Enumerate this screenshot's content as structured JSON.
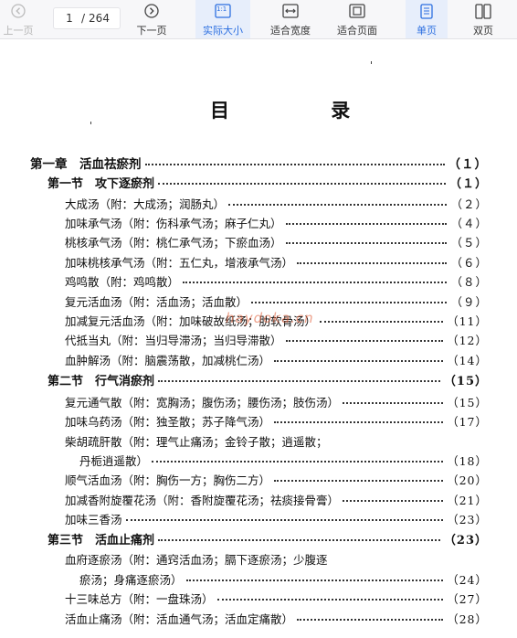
{
  "toolbar": {
    "prev_label": "上一页",
    "page_current": "1",
    "page_sep": "/",
    "page_total": "264",
    "next_label": "下一页",
    "actual_size_label": "实际大小",
    "actual_size_icon_text": "1:1",
    "fit_width_label": "适合宽度",
    "fit_page_label": "适合页面",
    "single_page_label": "单页",
    "double_page_label": "双页"
  },
  "document": {
    "title": "目 录",
    "watermark": "haydoka.cn",
    "lines": [
      {
        "level": "chapter",
        "text": "第一章　活血祛瘀剂",
        "page": "（１）"
      },
      {
        "level": "section",
        "text": "第一节　攻下逐瘀剂",
        "page": "（１）"
      },
      {
        "level": "item",
        "text": "大成汤（附：大成汤；润肠丸）",
        "page": "（２）"
      },
      {
        "level": "item",
        "text": "加味承气汤（附：伤科承气汤；麻子仁丸）",
        "page": "（４）"
      },
      {
        "level": "item",
        "text": "桃核承气汤（附：桃仁承气汤；下瘀血汤）",
        "page": "（５）"
      },
      {
        "level": "item",
        "text": "加味桃核承气汤（附：五仁丸，增液承气汤）",
        "page": "（６）"
      },
      {
        "level": "item",
        "text": "鸡鸣散（附：鸡鸣散）",
        "page": "（８）"
      },
      {
        "level": "item",
        "text": "复元活血汤（附：活血汤；活血散）",
        "page": "（９）"
      },
      {
        "level": "item",
        "text": "加减复元活血汤（附：加味破故纸汤；肋软骨汤）",
        "page": "（11）"
      },
      {
        "level": "item",
        "text": "代抵当丸（附：当归导滞汤；当归导滞散）",
        "page": "（12）"
      },
      {
        "level": "item",
        "text": "血肿解汤（附：脑震荡散，加减桃仁汤）",
        "page": "（14）"
      },
      {
        "level": "section",
        "text": "第二节　行气消瘀剂",
        "page": "（15）"
      },
      {
        "level": "item",
        "text": "复元通气散（附：宽胸汤；腹伤汤；腰伤汤；肢伤汤）",
        "page": "（15）"
      },
      {
        "level": "item",
        "text": "加味乌药汤（附：独圣散；苏子降气汤）",
        "page": "（17）"
      },
      {
        "level": "item",
        "text": "柴胡疏肝散（附：理气止痛汤；金铃子散；逍遥散；",
        "page": "",
        "nodots": true
      },
      {
        "level": "cont",
        "text": "丹栀逍遥散）",
        "page": "（18）"
      },
      {
        "level": "item",
        "text": "顺气活血汤（附：胸伤一方；胸伤二方）",
        "page": "（20）"
      },
      {
        "level": "item",
        "text": "加减香附旋覆花汤（附：香附旋覆花汤；祛痰接骨膏）",
        "page": "（21）"
      },
      {
        "level": "item",
        "text": "加味三香汤",
        "page": "（23）"
      },
      {
        "level": "section",
        "text": "第三节　活血止痛剂",
        "page": "（23）"
      },
      {
        "level": "item",
        "text": "血府逐瘀汤（附：通窍活血汤；膈下逐瘀汤；少腹逐",
        "page": "",
        "nodots": true
      },
      {
        "level": "cont",
        "text": "瘀汤；身痛逐瘀汤）",
        "page": "（24）"
      },
      {
        "level": "item",
        "text": "十三味总方（附：一盘珠汤）",
        "page": "（27）"
      },
      {
        "level": "item",
        "text": "活血止痛汤（附：活血通气汤；活血定痛散）",
        "page": "（28）"
      }
    ]
  }
}
